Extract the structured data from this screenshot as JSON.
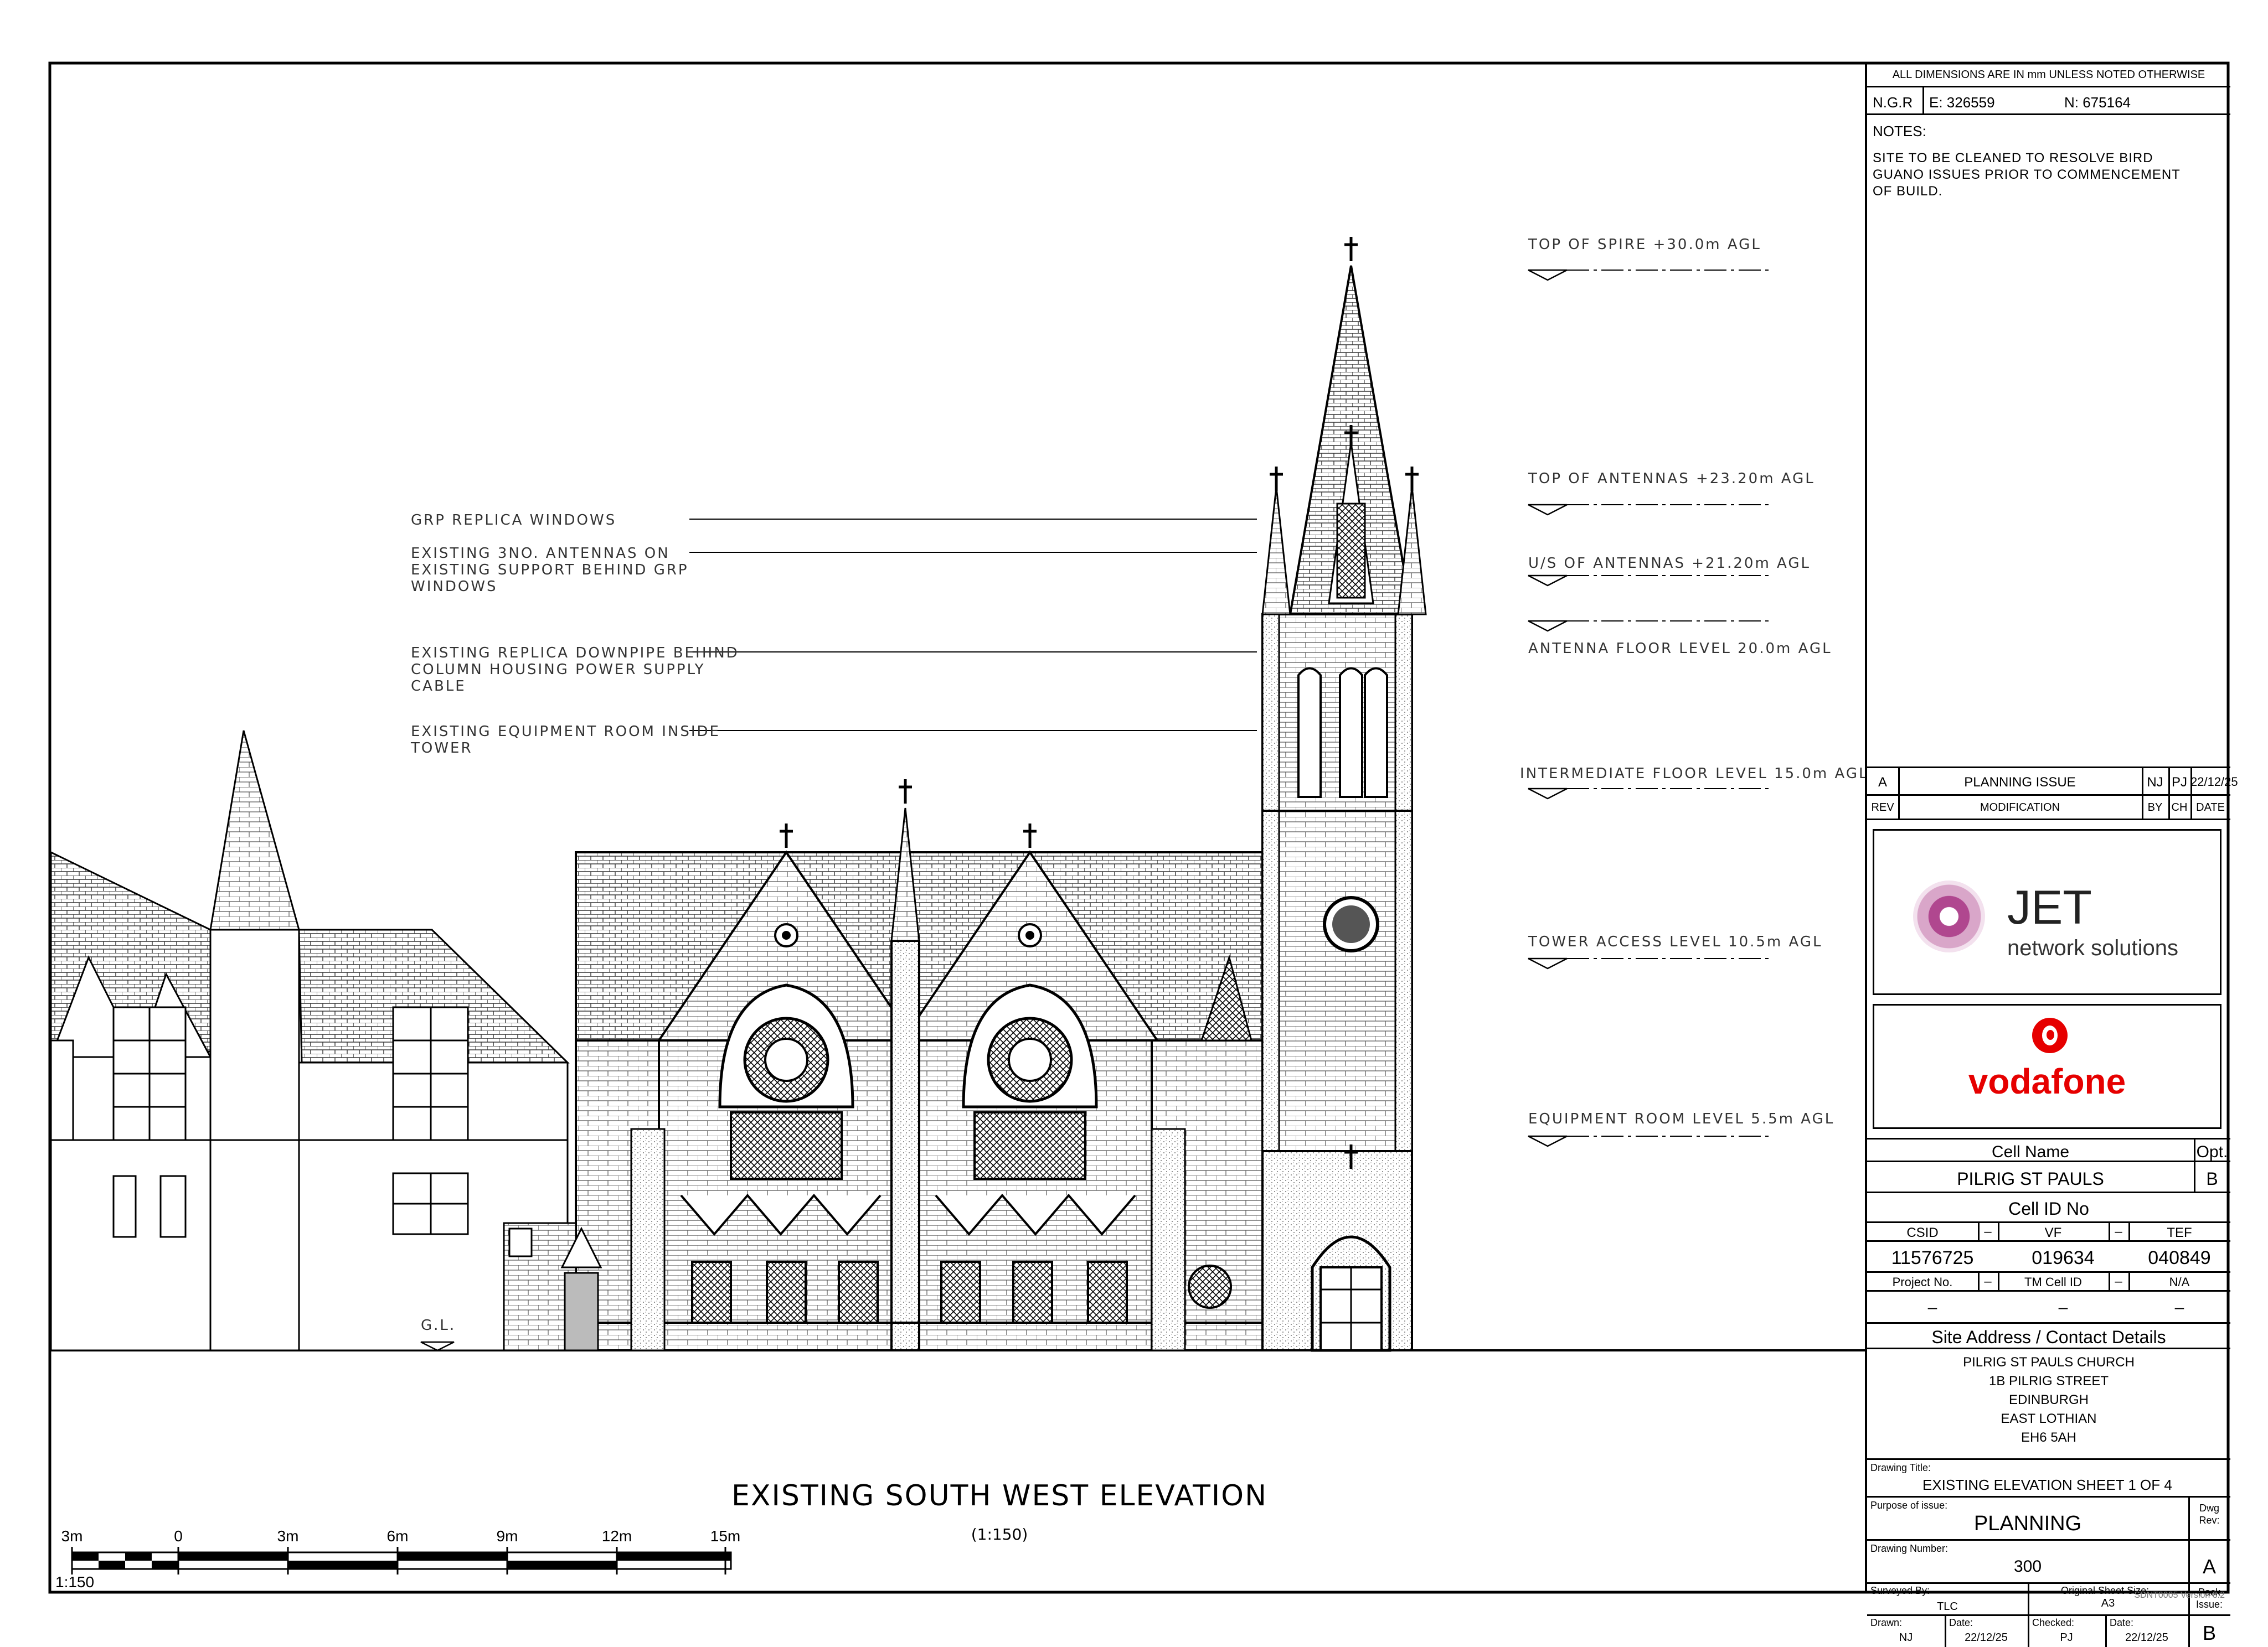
{
  "title_block": {
    "dimensions_note": "ALL DIMENSIONS ARE IN mm UNLESS NOTED OTHERWISE",
    "ngr_label": "N.G.R",
    "easting": "E: 326559",
    "northing": "N:  675164",
    "notes_heading": "NOTES:",
    "notes_lines": [
      "SITE TO BE CLEANED TO RESOLVE BIRD",
      "GUANO ISSUES PRIOR TO COMMENCEMENT",
      "OF BUILD."
    ],
    "revision": {
      "rev": "A",
      "modification": "PLANNING ISSUE",
      "by": "NJ",
      "ch": "PJ",
      "date": "22/12/25"
    },
    "revision_headers": {
      "rev": "REV",
      "modification": "MODIFICATION",
      "by": "BY",
      "ch": "CH",
      "date": "DATE"
    },
    "jet_logo": {
      "line1": "JET",
      "line2": "network solutions"
    },
    "vodafone_logo": "vodafone",
    "cell_name_label": "Cell Name",
    "opt_label": "Opt.",
    "cell_name": "PILRIG  ST  PAULS",
    "opt": "B",
    "cell_id_label": "Cell ID No",
    "csid_label": "CSID",
    "vf_label": "VF",
    "tef_label": "TEF",
    "dash": "–",
    "csid": "11576725",
    "vf": "019634",
    "tef": "040849",
    "project_no_label": "Project No.",
    "tm_cell_id_label": "TM Cell ID",
    "na": "N/A",
    "site_address_label": "Site Address / Contact Details",
    "address_lines": [
      "PILRIG  ST  PAULS  CHURCH",
      "1B  PILRIG  STREET",
      "EDINBURGH",
      "EAST  LOTHIAN",
      "EH6  5AH"
    ],
    "drawing_title_label": "Drawing Title:",
    "drawing_title": "EXISTING  ELEVATION  SHEET  1  OF  4",
    "purpose_label": "Purpose of issue:",
    "purpose": "PLANNING",
    "dwg_rev_label": "Dwg\nRev:",
    "drawing_number_label": "Drawing Number:",
    "drawing_number": "300",
    "dwg_rev": "A",
    "surveyed_by_label": "Surveyed By:",
    "surveyed_by": "TLC",
    "sheet_size_label": "Original Sheet Size:",
    "sheet_size": "A3",
    "pack_issue_label": "Pack\nIssue:",
    "pack_issue": "B",
    "drawn_label": "Drawn:",
    "drawn": "NJ",
    "date_label": "Date:",
    "date": "22/12/25",
    "checked_label": "Checked:",
    "checked": "PJ",
    "version": "SDNT0005 Version 3.2"
  },
  "annotations": {
    "left": [
      {
        "lines": [
          "GRP  REPLICA  WINDOWS"
        ]
      },
      {
        "lines": [
          "EXISTING  3NO.  ANTENNAS  ON",
          "EXISTING  SUPPORT  BEHIND  GRP",
          "WINDOWS"
        ]
      },
      {
        "lines": [
          "EXISTING  REPLICA  DOWNPIPE  BEHIND",
          "COLUMN  HOUSING  POWER  SUPPLY",
          "CABLE"
        ]
      },
      {
        "lines": [
          "EXISTING  EQUIPMENT  ROOM  INSIDE",
          "TOWER"
        ]
      }
    ],
    "levels": [
      "TOP  OF  SPIRE  +30.0m  AGL",
      "TOP  OF  ANTENNAS  +23.20m  AGL",
      "U/S  OF  ANTENNAS  +21.20m  AGL",
      "ANTENNA  FLOOR  LEVEL  20.0m  AGL",
      "INTERMEDIATE  FLOOR  LEVEL  15.0m  AGL",
      "TOWER  ACCESS  LEVEL  10.5m  AGL",
      "EQUIPMENT  ROOM  LEVEL  5.5m  AGL"
    ],
    "ground_level": "G.L."
  },
  "elevation_title": "EXISTING  SOUTH  WEST  ELEVATION",
  "elevation_scale": "(1:150)",
  "scale_bar": {
    "ticks": [
      "3m",
      "0",
      "3m",
      "6m",
      "9m",
      "12m",
      "15m"
    ],
    "ratio": "1:150"
  },
  "colors": {
    "line": "#000000",
    "vodafone_red": "#e60000",
    "jet_purple": "#8b1a6b",
    "brick": "#555555"
  }
}
